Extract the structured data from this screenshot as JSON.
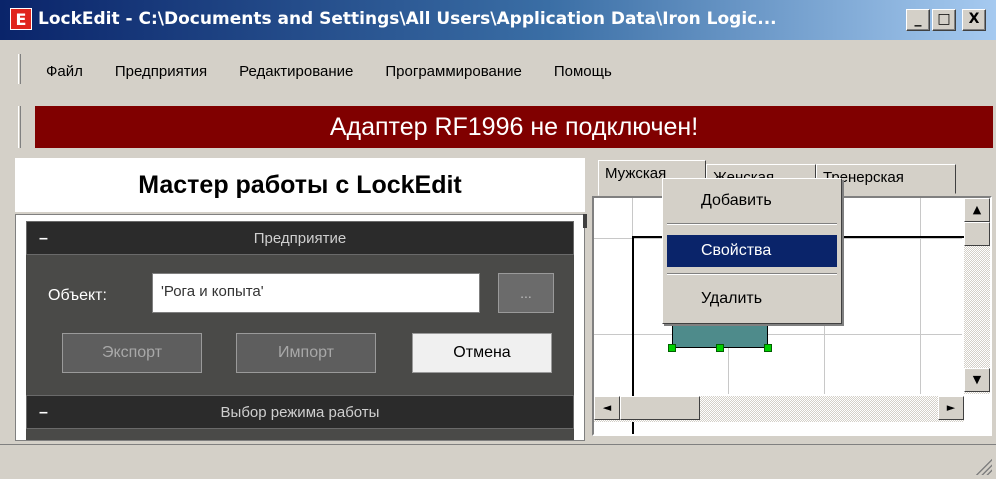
{
  "window": {
    "icon_letter": "E",
    "title": "LockEdit - C:\\Documents and Settings\\All Users\\Application Data\\Iron Logic...",
    "min_glyph": "_",
    "max_glyph": "□",
    "close_glyph": "X"
  },
  "menu": {
    "items": [
      "Файл",
      "Предприятия",
      "Редактирование",
      "Программирование",
      "Помощь"
    ]
  },
  "banner": {
    "text": "Адаптер RF1996 не подключен!",
    "color": "#800000"
  },
  "wizard": {
    "title": "Мастер работы с LockEdit",
    "sections": [
      {
        "collapse_glyph": "–",
        "header": "Предприятие",
        "object_label": "Объект:",
        "object_value": "'Рога и копыта'",
        "browse_label": "...",
        "buttons": {
          "export": "Экспорт",
          "import": "Импорт",
          "cancel": "Отмена"
        }
      },
      {
        "collapse_glyph": "–",
        "header": "Выбор режима работы"
      }
    ]
  },
  "plan": {
    "tabs": [
      "Мужская",
      "Женская",
      "Тренерская"
    ],
    "active_tab": "Мужская",
    "door_color": "#4e8b8b",
    "scroll_up": "▲",
    "scroll_down": "▼",
    "scroll_left": "◄",
    "scroll_right": "►"
  },
  "context_menu": {
    "items": [
      "Добавить",
      "Свойства",
      "Удалить"
    ],
    "highlighted": "Свойства"
  }
}
